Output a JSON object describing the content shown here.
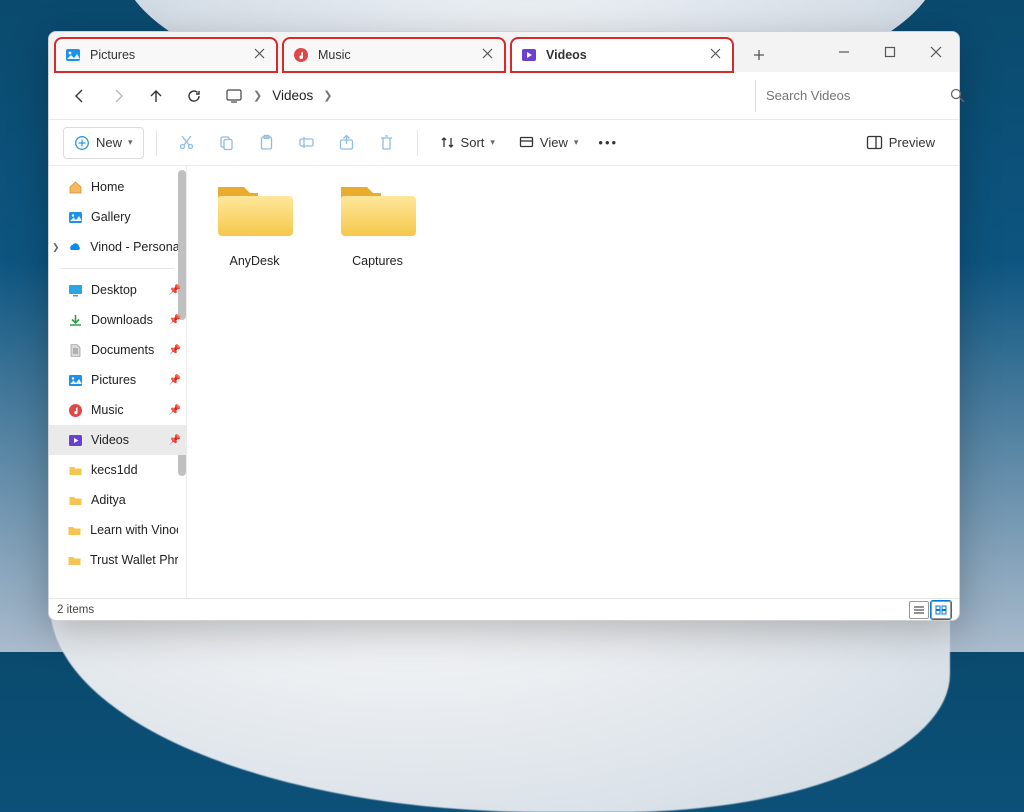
{
  "tabs": [
    {
      "label": "Pictures",
      "icon": "pictures",
      "active": false
    },
    {
      "label": "Music",
      "icon": "music",
      "active": false
    },
    {
      "label": "Videos",
      "icon": "videos",
      "active": true
    }
  ],
  "breadcrumb": {
    "current": "Videos"
  },
  "search": {
    "placeholder": "Search Videos"
  },
  "cmd": {
    "new": "New",
    "sort": "Sort",
    "view": "View",
    "preview": "Preview"
  },
  "sidebar": {
    "top": [
      {
        "label": "Home",
        "icon": "home"
      },
      {
        "label": "Gallery",
        "icon": "gallery"
      },
      {
        "label": "Vinod - Personal",
        "icon": "onedrive",
        "expandable": true
      }
    ],
    "pinned": [
      {
        "label": "Desktop",
        "icon": "desktop",
        "pin": true
      },
      {
        "label": "Downloads",
        "icon": "download",
        "pin": true
      },
      {
        "label": "Documents",
        "icon": "document",
        "pin": true
      },
      {
        "label": "Pictures",
        "icon": "pictures",
        "pin": true
      },
      {
        "label": "Music",
        "icon": "music",
        "pin": true
      },
      {
        "label": "Videos",
        "icon": "videos",
        "pin": true,
        "selected": true
      },
      {
        "label": "kecs1dd",
        "icon": "folder"
      },
      {
        "label": "Aditya",
        "icon": "folder"
      },
      {
        "label": "Learn with Vinod",
        "icon": "folder"
      },
      {
        "label": "Trust Wallet Phra",
        "icon": "folder"
      }
    ]
  },
  "folders": [
    {
      "name": "AnyDesk"
    },
    {
      "name": "Captures"
    }
  ],
  "status": {
    "text": "2 items"
  }
}
